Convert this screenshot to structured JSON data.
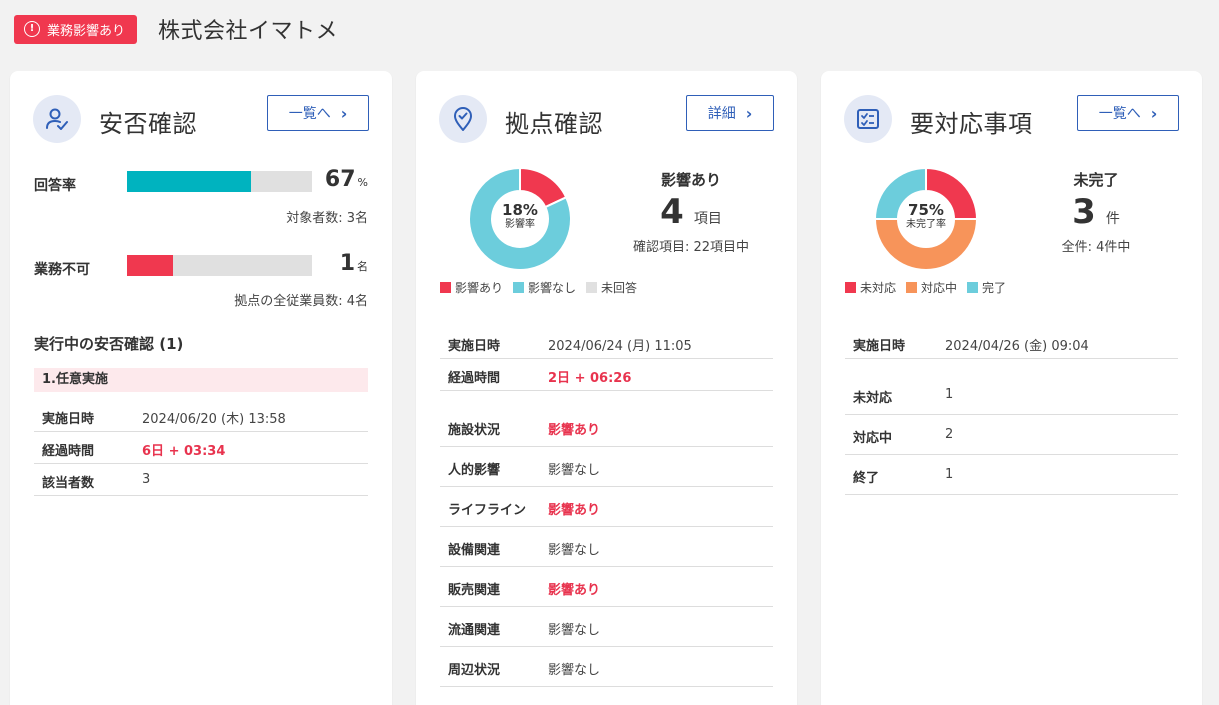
{
  "header": {
    "badge_label": "業務影響あり",
    "badge_icon": "alert-circle-icon",
    "company_name": "株式会社イマトメ",
    "badge_color": "#f0384f"
  },
  "safety": {
    "title": "安否確認",
    "icon": "user-check-icon",
    "button_label": "一覧へ",
    "response_rate": {
      "label": "回答率",
      "value": "67",
      "unit": "%",
      "fill_fraction": 0.67,
      "color": "#00b3bf",
      "note": "対象者数: 3名"
    },
    "unable": {
      "label": "業務不可",
      "value": "1",
      "unit": "名",
      "fill_fraction": 0.25,
      "color": "#f0384f",
      "note": "拠点の全従業員数: 4名"
    },
    "active_title": "実行中の安否確認 (1)",
    "active_item": "1.任意実施",
    "rows": [
      {
        "key": "実施日時",
        "value": "2024/06/20 (木) 13:58"
      },
      {
        "key": "経過時間",
        "value": "6日 + 03:34"
      },
      {
        "key": "該当者数",
        "value": "3"
      }
    ]
  },
  "site": {
    "title": "拠点確認",
    "icon": "location-check-icon",
    "button_label": "詳細",
    "donut": {
      "percent": "18%",
      "caption": "影響率",
      "affected": 0.18,
      "none": 0.82,
      "unanswered": 0
    },
    "legend": [
      "影響あり",
      "影響なし",
      "未回答"
    ],
    "colors": {
      "affected": "#f0384f",
      "none": "#6ccddc",
      "unanswered": "#e0e0e0"
    },
    "summary": {
      "title": "影響あり",
      "count": "4",
      "unit": "項目",
      "note": "確認項目: 22項目中"
    },
    "rows_top": [
      {
        "key": "実施日時",
        "value": "2024/06/24 (月) 11:05"
      },
      {
        "key": "経過時間",
        "value": "2日 + 06:26"
      }
    ],
    "rows": [
      {
        "key": "施設状況",
        "value": "影響あり"
      },
      {
        "key": "人的影響",
        "value": "影響なし"
      },
      {
        "key": "ライフライン",
        "value": "影響あり"
      },
      {
        "key": "設備関連",
        "value": "影響なし"
      },
      {
        "key": "販売関連",
        "value": "影響あり"
      },
      {
        "key": "流通関連",
        "value": "影響なし"
      },
      {
        "key": "周辺状況",
        "value": "影響なし"
      }
    ]
  },
  "tasks": {
    "title": "要対応事項",
    "icon": "checklist-icon",
    "button_label": "一覧へ",
    "donut": {
      "percent": "75%",
      "caption": "未完了率",
      "unhandled": 0.25,
      "in_progress": 0.5,
      "done": 0.25
    },
    "legend": [
      "未対応",
      "対応中",
      "完了"
    ],
    "colors": {
      "unhandled": "#f0384f",
      "in_progress": "#f7945a",
      "done": "#6ccddc"
    },
    "summary": {
      "title": "未完了",
      "count": "3",
      "unit": "件",
      "note": "全件: 4件中"
    },
    "rows_top": [
      {
        "key": "実施日時",
        "value": "2024/04/26 (金) 09:04"
      }
    ],
    "rows": [
      {
        "key": "未対応",
        "value": "1"
      },
      {
        "key": "対応中",
        "value": "2"
      },
      {
        "key": "終了",
        "value": "1"
      }
    ]
  }
}
